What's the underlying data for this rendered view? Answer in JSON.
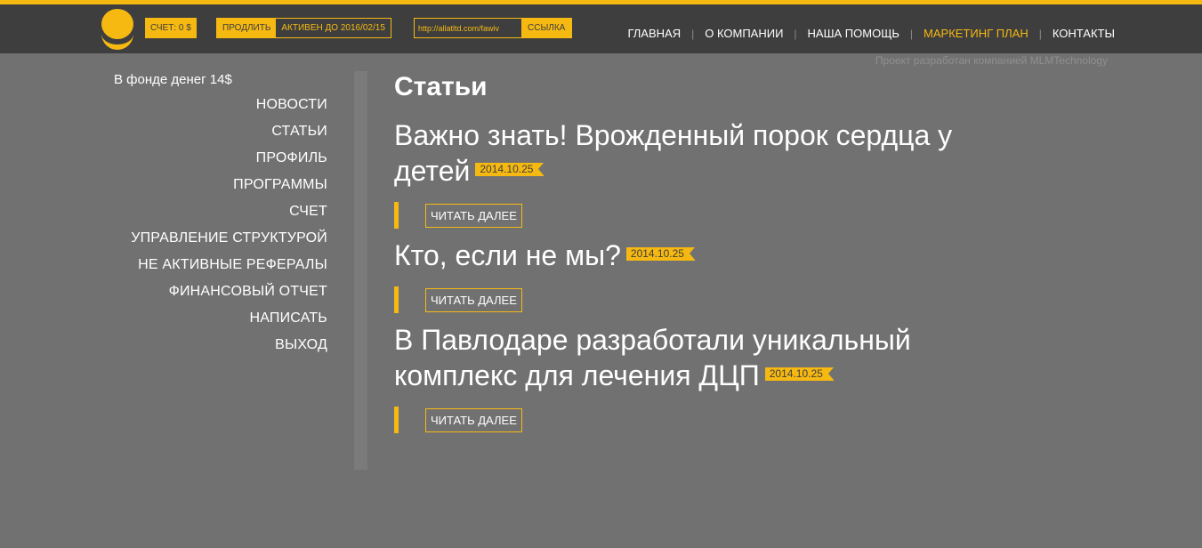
{
  "colors": {
    "accent": "#f6b912",
    "header_bg": "#3e3e3e",
    "page_bg": "#717171"
  },
  "logo": {
    "icon": "smiley-logo-icon"
  },
  "account": {
    "label": "СЧЕТ: 0 $"
  },
  "subscription": {
    "extend_label": "ПРОДЛИТЬ",
    "active_until": "АКТИВЕН ДО 2016/02/15"
  },
  "ref_link": {
    "value": "http://allatltd.com/fawiv",
    "button_label": "ССЫЛКА"
  },
  "topnav": [
    {
      "label": "ГЛАВНАЯ"
    },
    {
      "label": "О КОМПАНИИ"
    },
    {
      "label": "НАША ПОМОЩЬ"
    },
    {
      "label": "МАРКЕТИНГ ПЛАН"
    },
    {
      "label": "КОНТАКТЫ"
    }
  ],
  "topnav_separator": "|",
  "credit": "Проект разработан компанией MLMTechnology",
  "fund": "В фонде денег 14$",
  "sidenav": [
    {
      "label": "НОВОСТИ"
    },
    {
      "label": "СТАТЬИ"
    },
    {
      "label": "ПРОФИЛЬ"
    },
    {
      "label": "ПРОГРАММЫ"
    },
    {
      "label": "СЧЕТ"
    },
    {
      "label": "УПРАВЛЕНИЕ СТРУКТУРОЙ"
    },
    {
      "label": "НЕ АКТИВНЫЕ РЕФЕРАЛЫ"
    },
    {
      "label": "ФИНАНСОВЫЙ ОТЧЕТ"
    },
    {
      "label": "НАПИСАТЬ"
    },
    {
      "label": "ВЫХОД"
    }
  ],
  "main": {
    "title": "Статьи",
    "articles": [
      {
        "title": "Важно знать! Врожденный порок сердца у детей",
        "date": "2014.10.25",
        "more": "ЧИТАТЬ ДАЛЕЕ"
      },
      {
        "title": "Кто, если не мы?",
        "date": "2014.10.25",
        "more": "ЧИТАТЬ ДАЛЕЕ"
      },
      {
        "title": "В Павлодаре разработали уникальный комплекс для лечения ДЦП",
        "date": "2014.10.25",
        "more": "ЧИТАТЬ ДАЛЕЕ"
      }
    ]
  }
}
